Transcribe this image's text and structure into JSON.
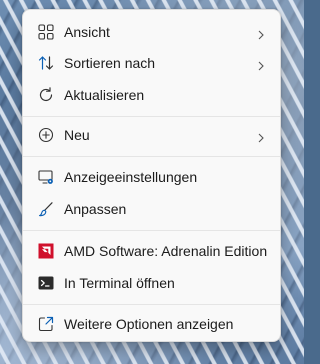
{
  "menu": {
    "items": [
      {
        "label": "Ansicht",
        "icon": "view-grid-icon",
        "submenu": true
      },
      {
        "label": "Sortieren nach",
        "icon": "sort-arrows-icon",
        "submenu": true
      },
      {
        "label": "Aktualisieren",
        "icon": "refresh-icon",
        "submenu": false
      },
      {
        "label": "Neu",
        "icon": "plus-circle-icon",
        "submenu": true
      },
      {
        "label": "Anzeigeeinstellungen",
        "icon": "display-settings-icon",
        "submenu": false
      },
      {
        "label": "Anpassen",
        "icon": "brush-icon",
        "submenu": false
      },
      {
        "label": "AMD Software: Adrenalin Edition",
        "icon": "amd-logo-icon",
        "submenu": false
      },
      {
        "label": "In Terminal öffnen",
        "icon": "terminal-icon",
        "submenu": false
      },
      {
        "label": "Weitere Optionen anzeigen",
        "icon": "open-external-icon",
        "submenu": false
      }
    ]
  },
  "colors": {
    "menu_background": "#f9f9f9",
    "text": "#1b1b1b",
    "accent_blue": "#0a5fb4",
    "amd_red": "#d0102c"
  }
}
